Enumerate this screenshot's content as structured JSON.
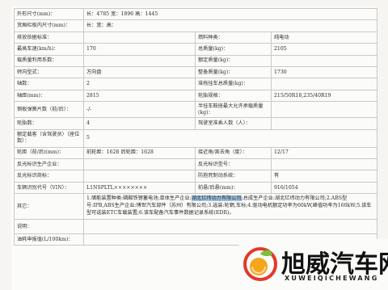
{
  "rows": [
    {
      "l1": "外形尺寸(mm)：",
      "v1": "长：4785 宽：1896 高：1445",
      "span": true
    },
    {
      "l1": "货厢栏板内尺寸(mm)：",
      "v1": "长：宽：高：",
      "span": true
    },
    {
      "l1": "排放依据标准：",
      "v1": "",
      "l2": "燃料种类：",
      "v2": "纯电动"
    },
    {
      "l1": "最高车速(km/h)：",
      "v1": "170",
      "l2": "总质量(kg)：",
      "v2": "2105"
    },
    {
      "l1": "载质量利用系数：",
      "v1": "",
      "l2": "额定质量(kg)：",
      "v2": ""
    },
    {
      "l1": "转向型式：",
      "v1": "方向盘",
      "l2": "整备质量(kg)：",
      "v2": "1730"
    },
    {
      "l1": "轴数：",
      "v1": "2",
      "l2": "准拖挂车总质量(kg)：",
      "v2": ""
    },
    {
      "l1": "轴距(mm)：",
      "v1": "2815",
      "l2": "轮胎规格：",
      "v2": "215/50R18,235/40R19"
    },
    {
      "l1": "钢板弹簧片数（前/后）：",
      "v1": "-/-",
      "l2": "半挂车鞍座最大允许承载质量(kg)：",
      "v2": ""
    },
    {
      "l1": "轮胎数：",
      "v1": "4",
      "l2": "驾驶室准乘人数（人）：",
      "v2": ""
    },
    {
      "l1": "额定载客（含驾驶员）（座位数）：",
      "v1": "5",
      "span": true
    },
    {
      "l1": "轮距（前/后)(mm)：",
      "v1": "前轮距：1628 后轮距：1628",
      "l2": "接近角/离去角（度）：",
      "v2": "12/17"
    },
    {
      "l1": "反光标识生产企业：",
      "v1": "",
      "l2": "反光标识型号：",
      "v2": ""
    },
    {
      "l1": "反光标识商标：",
      "v1": "",
      "l2": "防抱死制动系统：",
      "v2": "有"
    },
    {
      "l1": "车辆识别代号（VIN）：",
      "v1": "L1NSPLTL××××××××",
      "l2": "前悬/后悬(mm)：",
      "v2": "916/1054"
    }
  ],
  "other": {
    "label": "其它：",
    "text_before": "1.储能装置种类:磷酸铁锂蓄电池;单体生产企业:",
    "text_highlight": "湖北亿纬动力有限公司",
    "text_after": ";总成生产企业:湖北亿纬动力有限公司;2.ABS型号:IPB,ABS生产企业:博世汽车部件（苏州）有限公司;3.选装:轮辋,车标;4.驱动电机额定功率为60kW,峰值功率为160kW;5.该车型可选装ETC车载装置;6.该车配备汽车事件数据记录系统(EDR)。"
  },
  "remark": {
    "label": "说明："
  },
  "energy": {
    "label": "油耗申报值(L/100km)：",
    "value": ""
  },
  "logo": {
    "cn": "旭威汽车网",
    "en": "XUWEIQICHEWANG",
    "colors": {
      "ring": "#e23a2a",
      "sun": "#f4a51c",
      "leaf": "#7bbf3a"
    }
  }
}
